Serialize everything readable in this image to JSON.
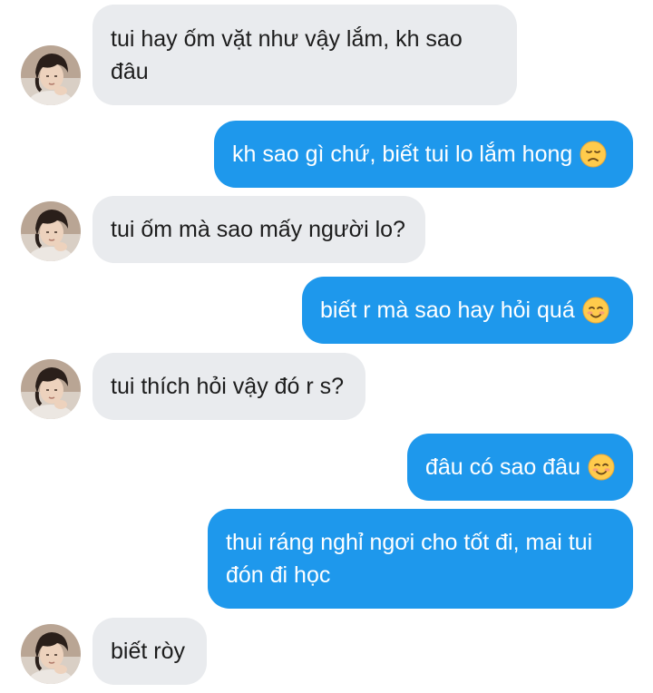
{
  "messages": [
    {
      "side": "in",
      "lines": [
        "tui hay ốm vặt như vậy lắm, kh sao",
        "đâu"
      ]
    },
    {
      "side": "out",
      "text": "kh sao gì chứ, biết tui lo lắm hong",
      "emoji": "disappointed-face-icon"
    },
    {
      "side": "in",
      "text": "tui ốm mà sao mấy người lo?"
    },
    {
      "side": "out",
      "text": "biết r mà sao hay hỏi quá",
      "emoji": "smiling-face-icon"
    },
    {
      "side": "in",
      "text": "tui thích hỏi vậy đó r s?"
    },
    {
      "side": "out",
      "text": "đâu có sao đâu",
      "emoji": "smiling-face-icon"
    },
    {
      "side": "out",
      "lines": [
        "thui ráng nghỉ ngơi cho tốt đi, mai tui",
        "đón đi học"
      ]
    },
    {
      "side": "in",
      "text": "biết ròy"
    }
  ],
  "colors": {
    "incoming_bubble": "#e9ebee",
    "outgoing_bubble": "#1e98ec",
    "incoming_text": "#1c1c1c",
    "outgoing_text": "#ffffff"
  }
}
